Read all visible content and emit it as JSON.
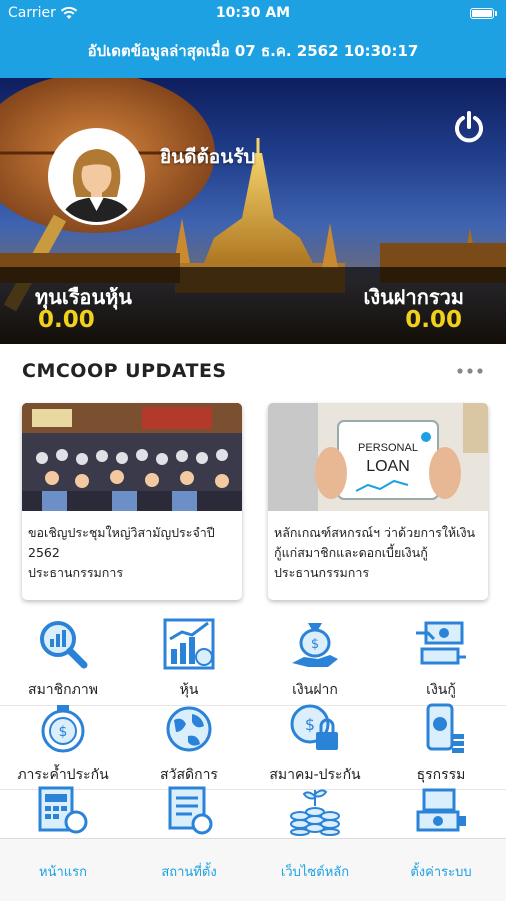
{
  "status_bar": {
    "carrier": "Carrier",
    "time": "10:30 AM"
  },
  "update_text": "อัปเดตข้อมูลล่าสุดเมื่อ 07 ธ.ค. 2562 10:30:17",
  "profile": {
    "welcome": "ยินดีต้อนรับ"
  },
  "balances": {
    "shares_label": "ทุนเรือนหุ้น",
    "shares_value": "0.00",
    "deposit_label": "เงินฝากรวม",
    "deposit_value": "0.00"
  },
  "updates": {
    "title": "CMCOOP UPDATES",
    "cards": [
      {
        "lines": [
          "ขอเชิญประชุมใหญ่วิสามัญประจำปี",
          "2562",
          "ประธานกรรมการ"
        ]
      },
      {
        "image_text": [
          "PERSONAL",
          "LOAN"
        ],
        "lines": [
          "หลักเกณฑ์สหกรณ์ฯ ว่าด้วยการให้เงิน",
          "กู้แก่สมาชิกและดอกเบี้ยเงินกู้",
          "ประธานกรรมการ"
        ]
      }
    ]
  },
  "menu": {
    "row1": [
      "สมาชิกภาพ",
      "หุ้น",
      "เงินฝาก",
      "เงินกู้"
    ],
    "row2": [
      "ภาระค้ำประกัน",
      "สวัสดิการ",
      "สมาคม-ประกัน",
      "ธุรกรรม"
    ]
  },
  "tabs": [
    "หน้าแรก",
    "สถานที่ตั้ง",
    "เว็บไซต์หลัก",
    "ตั้งค่าระบบ"
  ],
  "colors": {
    "primary": "#1da1e2",
    "balance_value": "#f1d11b",
    "icon_blue": "#2b83d8"
  }
}
